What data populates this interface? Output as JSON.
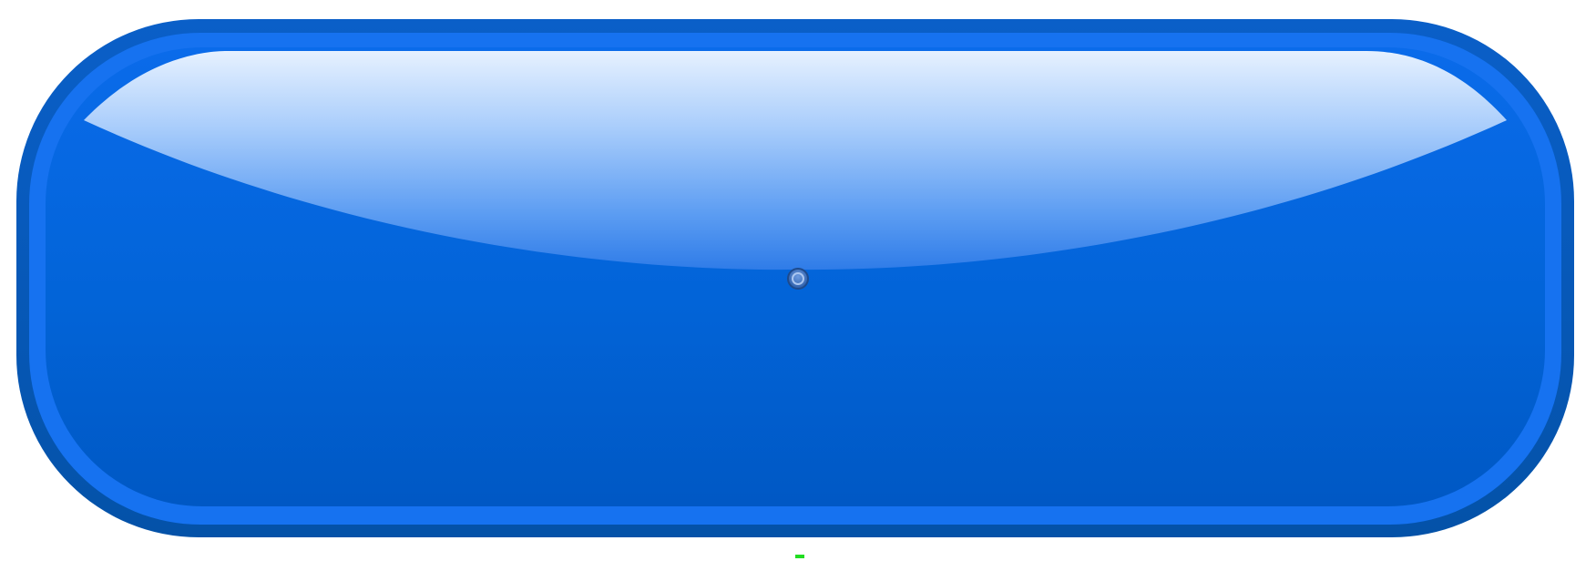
{
  "button": {
    "label": "",
    "shape": "rounded-pill",
    "colors": {
      "outer_rim": "#0559b8",
      "inner_rim": "#1672f0",
      "body_top": "#0a6bea",
      "body_bottom": "#0058c4",
      "gloss_top": "#e6f1ff",
      "gloss_bottom": "#3f88ee"
    }
  },
  "center_marker": {
    "icon": "circle-target-icon",
    "color": "#2b5ca8"
  },
  "bottom_tick": {
    "icon": "dash-icon",
    "color": "#22dd22"
  }
}
